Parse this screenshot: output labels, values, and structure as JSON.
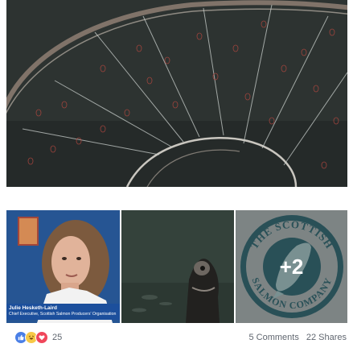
{
  "main_photo": {
    "icon": "salmon-pen-net-photo"
  },
  "thumbnails": [
    {
      "icon": "interview-photo",
      "lower_third": {
        "name": "Julie Hesketh-Laird",
        "title": "Chief Executive, Scottish Salmon Producers' Organisation"
      }
    },
    {
      "icon": "underwater-salmon-photo"
    },
    {
      "icon": "scottish-salmon-company-logo",
      "logo_text": "THE SCOTTISH SALMON COMPANY",
      "more_count": "+2"
    }
  ],
  "reactions": {
    "icons": [
      "like-icon",
      "haha-icon",
      "love-icon"
    ],
    "count": "25"
  },
  "comments_label": "5 Comments",
  "shares_label": "22 Shares",
  "colors": {
    "like": "#4a7fe6",
    "haha": "#f7c947",
    "love": "#f0475b",
    "muted_text": "#616770",
    "logo_teal": "#2c5b63",
    "lower_third_blue": "#1c4f9c"
  }
}
